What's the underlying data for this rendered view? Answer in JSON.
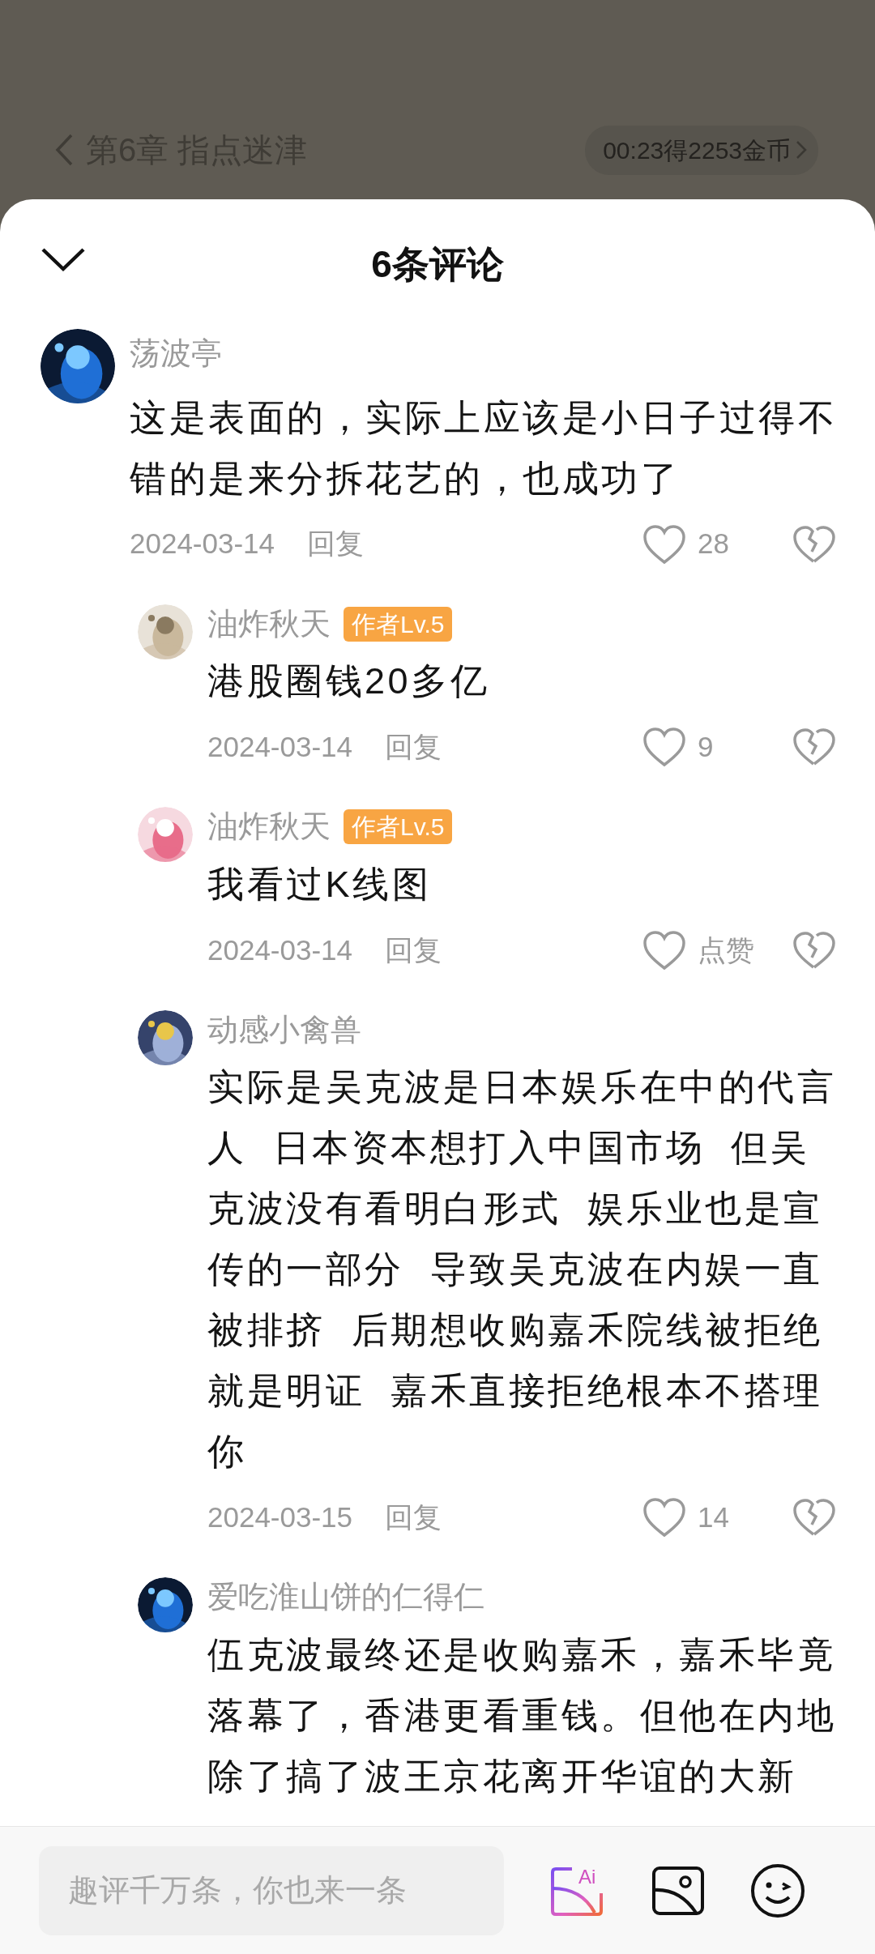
{
  "reader_header": {
    "chapter_title": "第6章 指点迷津",
    "reward_timer": "00:23得2253金币"
  },
  "comments_sheet": {
    "title": "6条评论",
    "comments": [
      {
        "author": "荡波亭",
        "text": "这是表面的，实际上应该是小日子过得不错的是来分拆花艺的，也成功了",
        "date": "2024-03-14",
        "reply_label": "回复",
        "likes": "28",
        "children": [
          {
            "author": "油炸秋天",
            "badge": "作者Lv.5",
            "text": "港股圈钱20多亿",
            "date": "2024-03-14",
            "reply_label": "回复",
            "likes": "9"
          },
          {
            "author": "油炸秋天",
            "badge": "作者Lv.5",
            "text": "我看过K线图",
            "date": "2024-03-14",
            "reply_label": "回复",
            "likes": "点赞"
          },
          {
            "author": "动感小禽兽",
            "text": "实际是吴克波是日本娱乐在中的代言人  日本资本想打入中国市场  但吴克波没有看明白形式  娱乐业也是宣传的一部分  导致吴克波在内娱一直被排挤  后期想收购嘉禾院线被拒绝就是明证  嘉禾直接拒绝根本不搭理你",
            "date": "2024-03-15",
            "reply_label": "回复",
            "likes": "14"
          },
          {
            "author": "爱吃淮山饼的仁得仁",
            "text": "伍克波最终还是收购嘉禾，嘉禾毕竟落幕了，香港更看重钱。但他在内地除了搞了波王京花离开华谊的大新"
          }
        ]
      }
    ]
  },
  "bottom_bar": {
    "input": {
      "placeholder": "趣评千万条，你也来一条"
    },
    "ai_button": {
      "label": "Ai"
    }
  }
}
